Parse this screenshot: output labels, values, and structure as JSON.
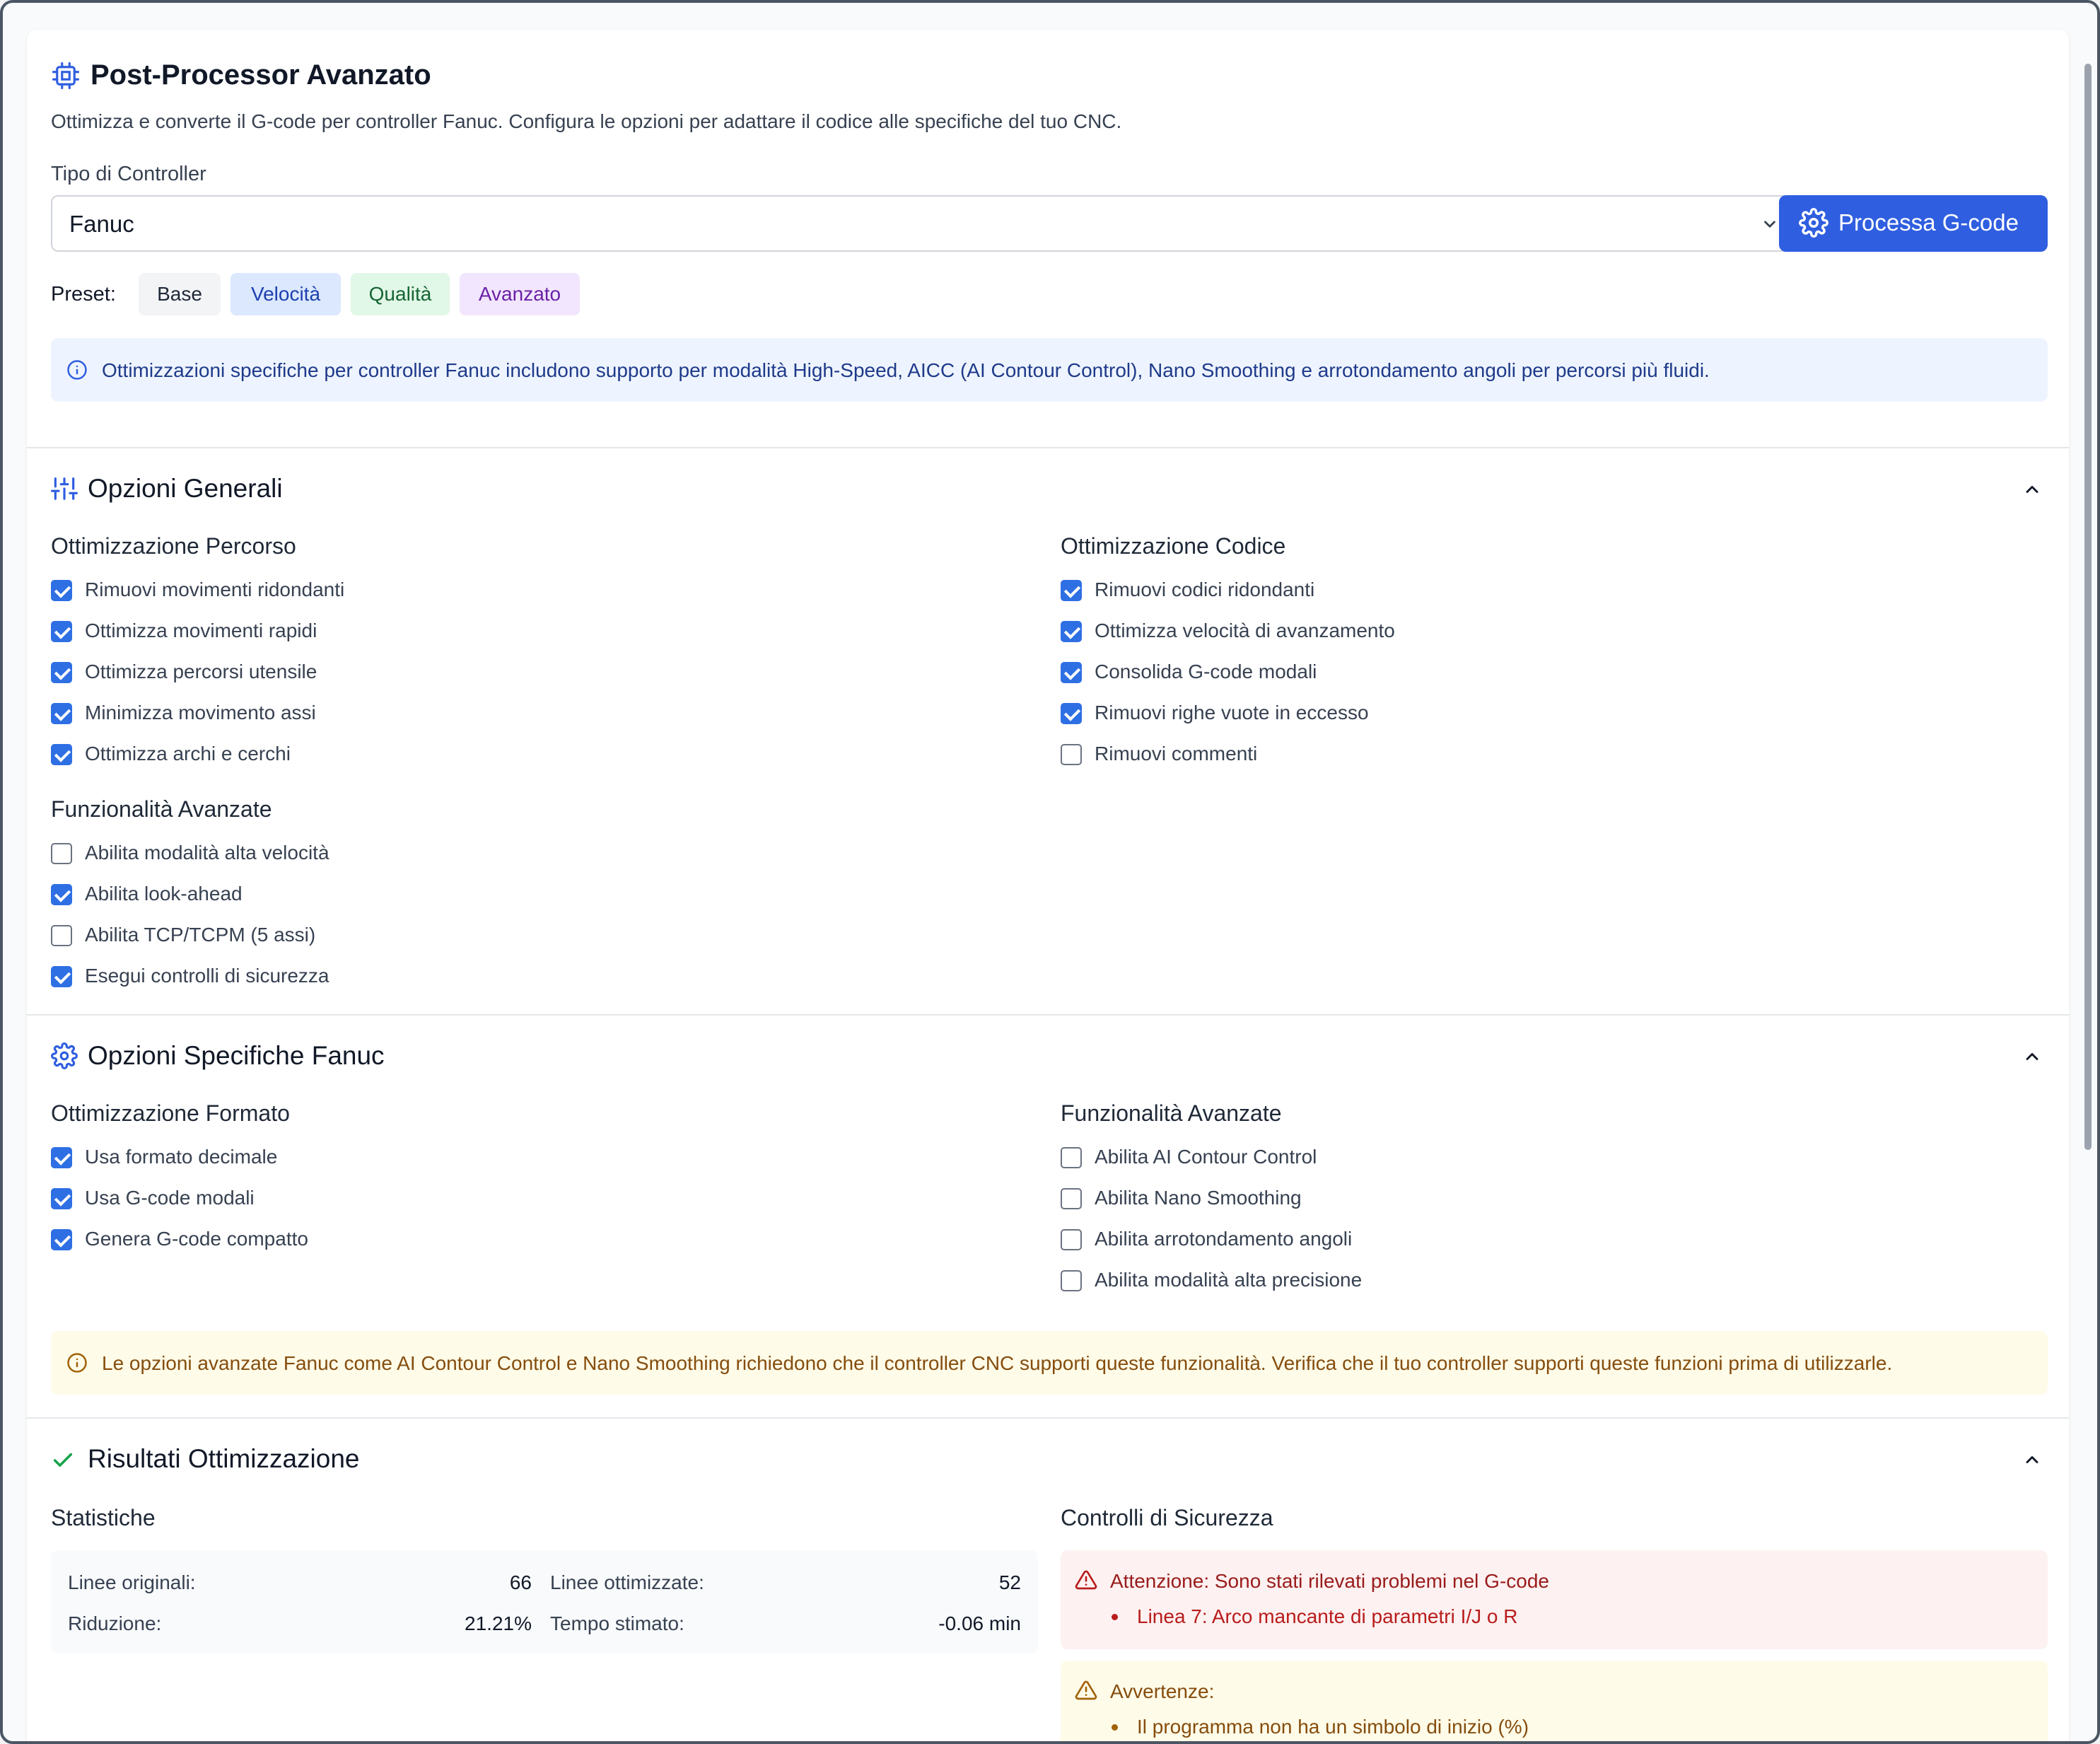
{
  "header": {
    "title": "Post-Processor Avanzato",
    "description": "Ottimizza e converte il G-code per controller Fanuc. Configura le opzioni per adattare il codice alle specifiche del tuo CNC.",
    "controller_label": "Tipo di Controller",
    "controller_value": "Fanuc",
    "process_button": "Processa G-code",
    "preset_label": "Preset:",
    "presets": [
      {
        "label": "Base"
      },
      {
        "label": "Velocità"
      },
      {
        "label": "Qualità"
      },
      {
        "label": "Avanzato"
      }
    ],
    "info_text": "Ottimizzazioni specifiche per controller Fanuc includono supporto per modalità High-Speed, AICC (AI Contour Control), Nano Smoothing e arrotondamento angoli per percorsi più fluidi."
  },
  "general": {
    "title": "Opzioni Generali",
    "path_title": "Ottimizzazione Percorso",
    "path_items": [
      {
        "label": "Rimuovi movimenti ridondanti",
        "checked": true
      },
      {
        "label": "Ottimizza movimenti rapidi",
        "checked": true
      },
      {
        "label": "Ottimizza percorsi utensile",
        "checked": true
      },
      {
        "label": "Minimizza movimento assi",
        "checked": true
      },
      {
        "label": "Ottimizza archi e cerchi",
        "checked": true
      }
    ],
    "code_title": "Ottimizzazione Codice",
    "code_items": [
      {
        "label": "Rimuovi codici ridondanti",
        "checked": true
      },
      {
        "label": "Ottimizza velocità di avanzamento",
        "checked": true
      },
      {
        "label": "Consolida G-code modali",
        "checked": true
      },
      {
        "label": "Rimuovi righe vuote in eccesso",
        "checked": true
      },
      {
        "label": "Rimuovi commenti",
        "checked": false
      }
    ],
    "adv_title": "Funzionalità Avanzate",
    "adv_items": [
      {
        "label": "Abilita modalità alta velocità",
        "checked": false
      },
      {
        "label": "Abilita look-ahead",
        "checked": true
      },
      {
        "label": "Abilita TCP/TCPM (5 assi)",
        "checked": false
      },
      {
        "label": "Esegui controlli di sicurezza",
        "checked": true
      }
    ]
  },
  "fanuc": {
    "title": "Opzioni Specifiche Fanuc",
    "format_title": "Ottimizzazione Formato",
    "format_items": [
      {
        "label": "Usa formato decimale",
        "checked": true
      },
      {
        "label": "Usa G-code modali",
        "checked": true
      },
      {
        "label": "Genera G-code compatto",
        "checked": true
      }
    ],
    "adv_title": "Funzionalità Avanzate",
    "adv_items": [
      {
        "label": "Abilita AI Contour Control",
        "checked": false
      },
      {
        "label": "Abilita Nano Smoothing",
        "checked": false
      },
      {
        "label": "Abilita arrotondamento angoli",
        "checked": false
      },
      {
        "label": "Abilita modalità alta precisione",
        "checked": false
      }
    ],
    "warning_text": "Le opzioni avanzate Fanuc come AI Contour Control e Nano Smoothing richiedono che il controller CNC supporti queste funzionalità. Verifica che il tuo controller supporti queste funzioni prima di utilizzarle."
  },
  "results": {
    "title": "Risultati Ottimizzazione",
    "stats_title": "Statistiche",
    "original_label": "Linee originali:",
    "original_value": "66",
    "optimized_label": "Linee ottimizzate:",
    "optimized_value": "52",
    "reduction_label": "Riduzione:",
    "reduction_value": "21.21%",
    "time_label": "Tempo stimato:",
    "time_value": "-0.06 min",
    "safety_title": "Controlli di Sicurezza",
    "error_title": "Attenzione: Sono stati rilevati problemi nel G-code",
    "error_item": "Linea 7: Arco mancante di parametri I/J o R",
    "warning_title": "Avvertenze:",
    "warning_item": "Il programma non ha un simbolo di inizio (%)"
  },
  "colors": {
    "primary": "#2f5ee0",
    "checkbox": "#2f6fe4",
    "success": "#16a34a",
    "error": "#b91c1c",
    "warning": "#a16207"
  }
}
